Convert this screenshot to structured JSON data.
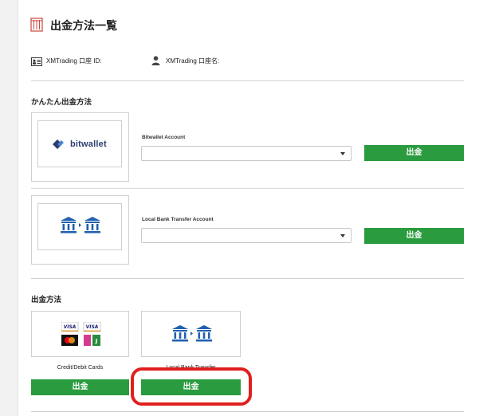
{
  "page": {
    "title": "出金方法一覧"
  },
  "account_info": {
    "id_label": "XMTrading 口座 ID:",
    "name_label": "XMTrading 口座名:"
  },
  "quick_section": {
    "title": "かんたん出金方法",
    "items": [
      {
        "field_label": "Bitwallet Account",
        "logo_text": "bitwallet",
        "button_label": "出金"
      },
      {
        "field_label": "Local Bank Transfer Account",
        "button_label": "出金"
      }
    ]
  },
  "methods_section": {
    "title": "出金方法",
    "cards": [
      {
        "caption": "Credit/Debit Cards",
        "button_label": "出金",
        "card_badges": [
          "VISA",
          "VISA"
        ]
      },
      {
        "caption": "Local Bank Transfer",
        "button_label": "出金"
      }
    ]
  },
  "colors": {
    "button_green": "#2a9b3e",
    "highlight_red": "#e0201e",
    "bank_blue": "#1f5fae"
  }
}
